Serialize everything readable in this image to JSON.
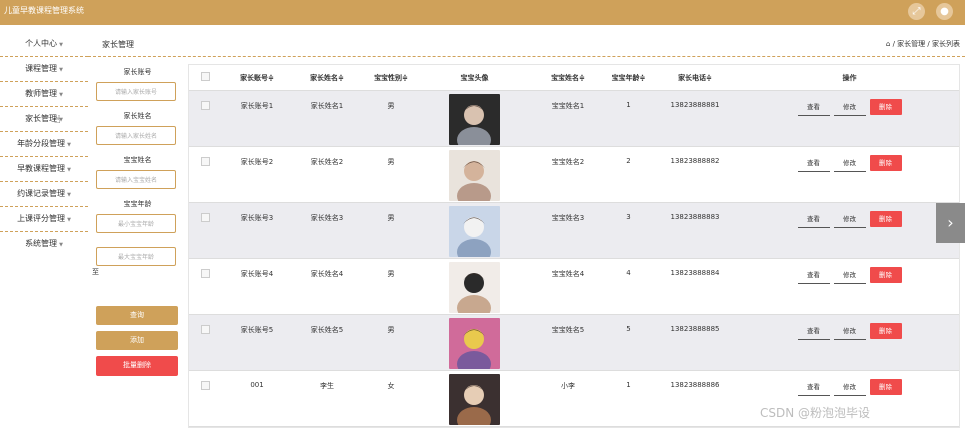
{
  "app": {
    "title": "儿童早教课程管理系统"
  },
  "icons": {
    "expand": "expand-icon",
    "user": "user-icon",
    "home": "home-icon",
    "next": "chevron-right-icon"
  },
  "colors": {
    "brand": "#cfa15a",
    "danger": "#f04b4b"
  },
  "sidebar": {
    "items": [
      {
        "label": "个人中心"
      },
      {
        "label": "课程管理"
      },
      {
        "label": "教师管理"
      },
      {
        "label": "家长管理"
      },
      {
        "label": "年龄分段管理"
      },
      {
        "label": "早教课程管理"
      },
      {
        "label": "约课记录管理"
      },
      {
        "label": "上课评分管理"
      },
      {
        "label": "系统管理"
      }
    ]
  },
  "header": {
    "page_title": "家长管理",
    "breadcrumb": "/ 家长管理 / 家长列表"
  },
  "search": {
    "account_label": "家长账号",
    "account_placeholder": "请输入家长账号",
    "name_label": "家长姓名",
    "name_placeholder": "请输入家长姓名",
    "baby_name_label": "宝宝姓名",
    "baby_name_placeholder": "请输入宝宝姓名",
    "age_label": "宝宝年龄",
    "age_min_placeholder": "最小宝宝年龄",
    "to_label": "至",
    "age_max_placeholder": "最大宝宝年龄",
    "search_button": "查询",
    "add_button": "添加",
    "batch_delete_button": "批量删除"
  },
  "table": {
    "columns": [
      "家长账号",
      "家长姓名",
      "宝宝性别",
      "宝宝头像",
      "宝宝姓名",
      "宝宝年龄",
      "家长电话",
      "操作"
    ],
    "sort_mark": "≑",
    "view_label": "查看",
    "edit_label": "修改",
    "delete_label": "删除",
    "rows": [
      {
        "account": "家长账号1",
        "name": "家长姓名1",
        "gender": "男",
        "baby_name": "宝宝姓名1",
        "age": "1",
        "phone": "13823888881"
      },
      {
        "account": "家长账号2",
        "name": "家长姓名2",
        "gender": "男",
        "baby_name": "宝宝姓名2",
        "age": "2",
        "phone": "13823888882"
      },
      {
        "account": "家长账号3",
        "name": "家长姓名3",
        "gender": "男",
        "baby_name": "宝宝姓名3",
        "age": "3",
        "phone": "13823888883"
      },
      {
        "account": "家长账号4",
        "name": "家长姓名4",
        "gender": "男",
        "baby_name": "宝宝姓名4",
        "age": "4",
        "phone": "13823888884"
      },
      {
        "account": "家长账号5",
        "name": "家长姓名5",
        "gender": "男",
        "baby_name": "宝宝姓名5",
        "age": "5",
        "phone": "13823888885"
      },
      {
        "account": "001",
        "name": "李生",
        "gender": "女",
        "baby_name": "小李",
        "age": "1",
        "phone": "13823888886"
      }
    ]
  },
  "watermark": "CSDN @粉泡泡毕设"
}
